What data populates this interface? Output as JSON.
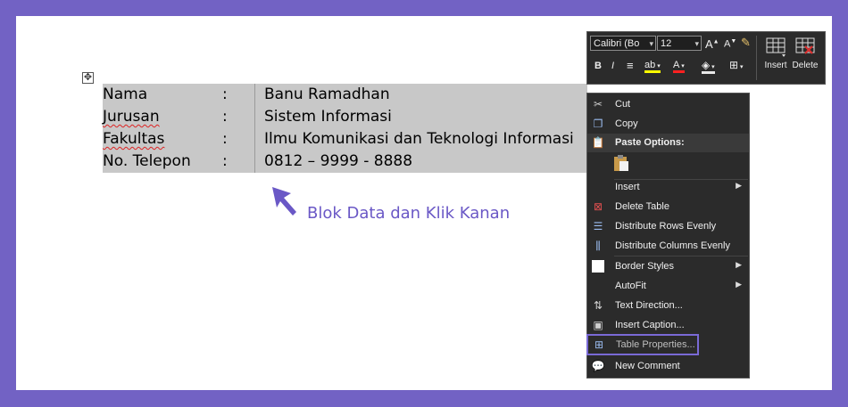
{
  "table": {
    "rows": [
      {
        "label": "Nama",
        "sep": ":",
        "value": "Banu Ramadhan"
      },
      {
        "label": "Jurusan",
        "sep": ":",
        "value": "Sistem Informasi"
      },
      {
        "label": "Fakultas",
        "sep": ":",
        "value": "Ilmu Komunikasi dan Teknologi Informasi"
      },
      {
        "label": "No. Telepon",
        "sep": ":",
        "value": "0812 – 9999 - 8888"
      }
    ]
  },
  "annotation": {
    "text": "Blok Data dan Klik Kanan",
    "color": "#6a58c6"
  },
  "mini_toolbar": {
    "font_name": "Calibri (Bo",
    "font_size": "12",
    "grow_font": "A",
    "shrink_font": "A",
    "bold": "B",
    "italic": "I",
    "highlight": "ab",
    "font_color": "A",
    "insert_label": "Insert",
    "delete_label": "Delete"
  },
  "context_menu": {
    "cut": "Cut",
    "copy": "Copy",
    "paste_options": "Paste Options:",
    "insert": "Insert",
    "delete_table": "Delete Table",
    "distribute_rows": "Distribute Rows Evenly",
    "distribute_columns": "Distribute Columns Evenly",
    "border_styles": "Border Styles",
    "autofit": "AutoFit",
    "text_direction": "Text Direction...",
    "insert_caption": "Insert Caption...",
    "table_properties": "Table Properties...",
    "new_comment": "New Comment"
  },
  "colors": {
    "frame": "#7262c4",
    "selection": "#c8c8c8",
    "menu_bg": "#2b2b2b",
    "highlight_outline": "#7a6ad6"
  }
}
